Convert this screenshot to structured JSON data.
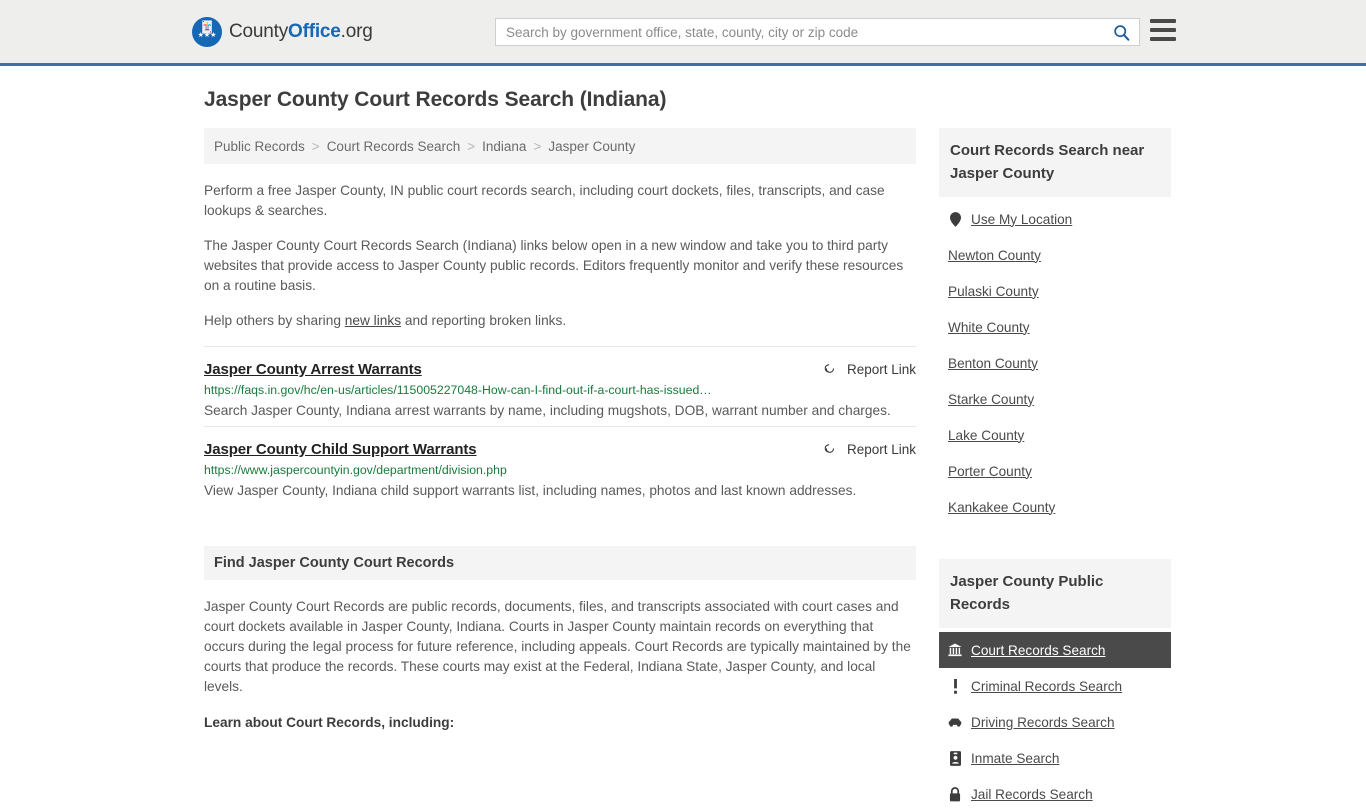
{
  "header": {
    "logo": {
      "part1": "County",
      "part2": "Office",
      "part3": ".org",
      "mark_icon": "eagle-logo-icon"
    },
    "search": {
      "placeholder": "Search by government office, state, county, city or zip code",
      "value": "",
      "search_icon": "search-icon"
    },
    "menu_icon": "hamburger-menu-icon"
  },
  "main": {
    "title": "Jasper County Court Records Search (Indiana)",
    "breadcrumb": [
      "Public Records",
      "Court Records Search",
      "Indiana",
      "Jasper County"
    ],
    "breadcrumb_separator": ">",
    "intro": {
      "p1": "Perform a free Jasper County, IN public court records search, including court dockets, files, transcripts, and case lookups & searches.",
      "p2": "The Jasper County Court Records Search (Indiana) links below open in a new window and take you to third party websites that provide access to Jasper County public records. Editors frequently monitor and verify these resources on a routine basis.",
      "p3_before": "Help others by sharing ",
      "p3_link": "new links",
      "p3_after": " and reporting broken links."
    },
    "report_link_label": "Report Link",
    "report_link_icon": "broken-link-icon",
    "results": [
      {
        "title": "Jasper County Arrest Warrants",
        "url": "https://faqs.in.gov/hc/en-us/articles/115005227048-How-can-I-find-out-if-a-court-has-issued…",
        "description": "Search Jasper County, Indiana arrest warrants by name, including mugshots, DOB, warrant number and charges."
      },
      {
        "title": "Jasper County Child Support Warrants",
        "url": "https://www.jaspercountyin.gov/department/division.php",
        "description": "View Jasper County, Indiana child support warrants list, including names, photos and last known addresses."
      }
    ],
    "section": {
      "heading": "Find Jasper County Court Records",
      "body": "Jasper County Court Records are public records, documents, files, and transcripts associated with court cases and court dockets available in Jasper County, Indiana. Courts in Jasper County maintain records on everything that occurs during the legal process for future reference, including appeals. Court Records are typically maintained by the courts that produce the records. These courts may exist at the Federal, Indiana State, Jasper County, and local levels.",
      "subheading": "Learn about Court Records, including:"
    }
  },
  "sidebar": {
    "nearby": {
      "heading": "Court Records Search near Jasper County",
      "use_my_location": {
        "label": "Use My Location",
        "icon": "map-pin-icon"
      },
      "counties": [
        "Newton County",
        "Pulaski County",
        "White County",
        "Benton County",
        "Starke County",
        "Lake County",
        "Porter County",
        "Kankakee County"
      ]
    },
    "public_records": {
      "heading": "Jasper County Public Records",
      "items": [
        {
          "label": "Court Records Search",
          "icon": "courthouse-icon",
          "active": true
        },
        {
          "label": "Criminal Records Search",
          "icon": "exclamation-icon",
          "active": false
        },
        {
          "label": "Driving Records Search",
          "icon": "car-icon",
          "active": false
        },
        {
          "label": "Inmate Search",
          "icon": "id-badge-icon",
          "active": false
        },
        {
          "label": "Jail Records Search",
          "icon": "lock-icon",
          "active": false
        }
      ]
    }
  },
  "colors": {
    "brand_blue": "#1667b4",
    "header_rule": "#3b72a8",
    "url_green": "#1a7a3c",
    "active_bg": "#4a4a4a",
    "panel_gray": "#f4f4f4"
  }
}
